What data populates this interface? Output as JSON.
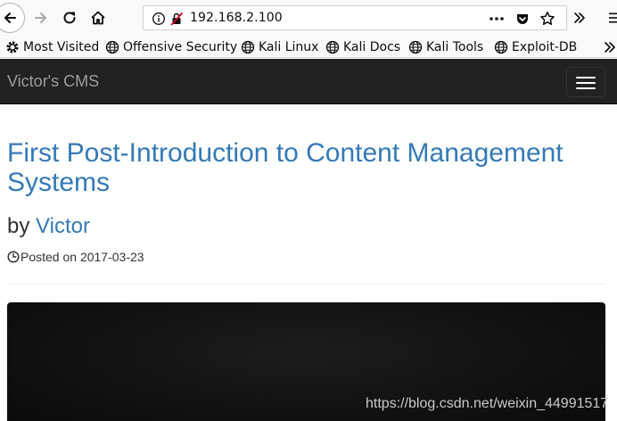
{
  "browser": {
    "url": "192.168.2.100",
    "bookmarks": [
      {
        "label": "Most Visited",
        "icon": "gear-icon"
      },
      {
        "label": "Offensive Security",
        "icon": "globe-icon"
      },
      {
        "label": "Kali Linux",
        "icon": "globe-icon"
      },
      {
        "label": "Kali Docs",
        "icon": "globe-icon"
      },
      {
        "label": "Kali Tools",
        "icon": "globe-icon"
      },
      {
        "label": "Exploit-DB",
        "icon": "globe-icon"
      }
    ]
  },
  "site": {
    "brand": "Victor's CMS"
  },
  "post": {
    "title": "First Post-Introduction to Content Management Systems",
    "by_prefix": "by",
    "author": "Victor",
    "posted_label": "Posted on 2017-03-23"
  },
  "watermark": "https://blog.csdn.net/weixin_44991517",
  "colors": {
    "link": "#337ab7",
    "navbar": "#222222",
    "brand": "#9d9d9d"
  }
}
